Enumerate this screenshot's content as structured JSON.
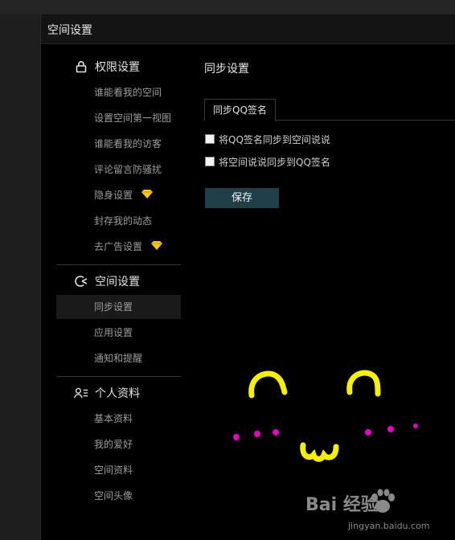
{
  "dialog": {
    "title": "空间设置"
  },
  "sidebar": {
    "sections": [
      {
        "title": "权限设置",
        "icon": "lock-icon",
        "items": [
          {
            "label": "谁能看我的空间"
          },
          {
            "label": "设置空间第一视图"
          },
          {
            "label": "谁能看我的访客"
          },
          {
            "label": "评论留言防骚扰"
          },
          {
            "label": "隐身设置",
            "badge": "diamond-icon"
          },
          {
            "label": "封存我的动态"
          },
          {
            "label": "去广告设置",
            "badge": "diamond-icon"
          }
        ]
      },
      {
        "title": "空间设置",
        "icon": "space-settings-icon",
        "items": [
          {
            "label": "同步设置",
            "active": true
          },
          {
            "label": "应用设置"
          },
          {
            "label": "通知和提醒"
          }
        ]
      },
      {
        "title": "个人资料",
        "icon": "profile-icon",
        "items": [
          {
            "label": "基本资料"
          },
          {
            "label": "我的爱好"
          },
          {
            "label": "空间资料"
          },
          {
            "label": "空间头像"
          }
        ]
      }
    ]
  },
  "main": {
    "title": "同步设置",
    "tab": "同步QQ签名",
    "options": [
      {
        "label": "将QQ签名同步到空间说说",
        "checked": false
      },
      {
        "label": "将空间说说同步到QQ签名",
        "checked": false
      }
    ],
    "save_label": "保存"
  },
  "watermark": {
    "text": "Bai 经验",
    "sub": "jingyan.baidu.com"
  },
  "colors": {
    "accent_button": "#1f3f49",
    "diamond": "#f5c518",
    "doodle_yellow": "#f5f000",
    "doodle_pink": "#e800c8"
  }
}
